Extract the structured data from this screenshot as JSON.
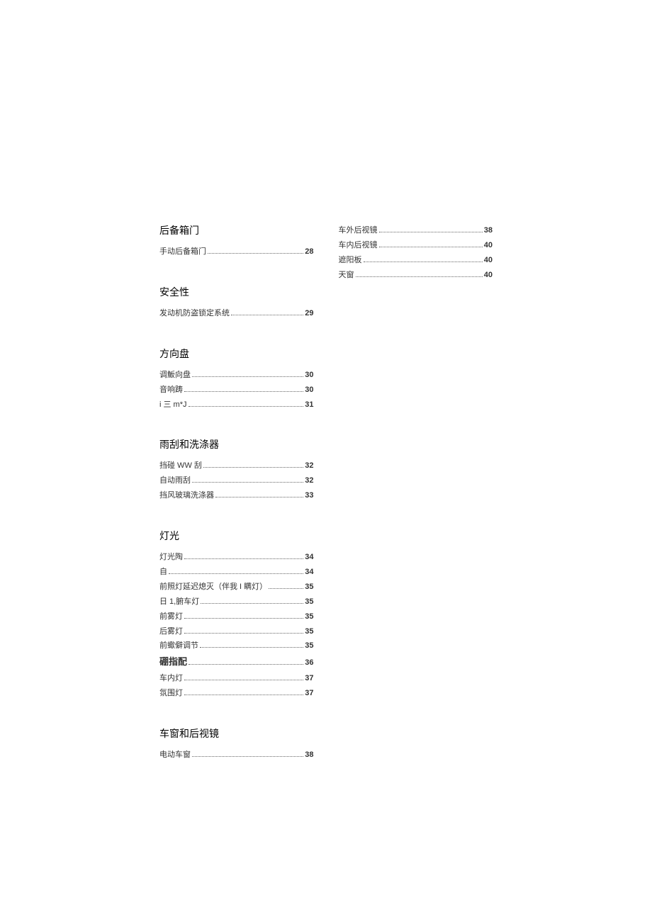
{
  "left": {
    "sections": [
      {
        "title": "后备箱门",
        "entries": [
          {
            "label": "手动后备箱门",
            "page": "28"
          }
        ]
      },
      {
        "title": "安全性",
        "entries": [
          {
            "label": "发动机防盗锁定系统",
            "page": "29"
          }
        ]
      },
      {
        "title": "方向盘",
        "entries": [
          {
            "label": "调魬向盘",
            "page": "30"
          },
          {
            "label": "音响踌",
            "page": "30"
          },
          {
            "label": "i 三 m*J",
            "page": "31"
          }
        ]
      },
      {
        "title": "雨刮和洗涤器",
        "entries": [
          {
            "label": "挡碰 WW 刮",
            "page": "32"
          },
          {
            "label": "自动雨刮",
            "page": "32"
          },
          {
            "label": "挡风玻璃洗涤器",
            "page": "33"
          }
        ]
      },
      {
        "title": "灯光",
        "entries": [
          {
            "label": "灯光陶",
            "page": "34"
          },
          {
            "label": "自",
            "page": "34"
          },
          {
            "label": "前照灯延迟熄灭（伴我 I 瞒灯）",
            "page": "35"
          },
          {
            "label": "日 1,腑车灯",
            "page": "35"
          },
          {
            "label": "前雾灯",
            "page": "35"
          },
          {
            "label": "后雾灯",
            "page": "35"
          },
          {
            "label": "前蠍僻调节",
            "page": "35"
          },
          {
            "label": "硼指配",
            "page": "36",
            "bold": true
          },
          {
            "label": "车内灯",
            "page": "37"
          },
          {
            "label": "氛围灯",
            "page": "37"
          }
        ]
      },
      {
        "title": "车窗和后视镜",
        "entries": [
          {
            "label": "电动车窗",
            "page": "38"
          }
        ]
      }
    ]
  },
  "right": {
    "entries": [
      {
        "label": "车外后视镜",
        "page": "38"
      },
      {
        "label": "车内后视镜",
        "page": "40"
      },
      {
        "label": "遮阳板",
        "page": "40"
      },
      {
        "label": "天窗",
        "page": "40"
      }
    ]
  }
}
